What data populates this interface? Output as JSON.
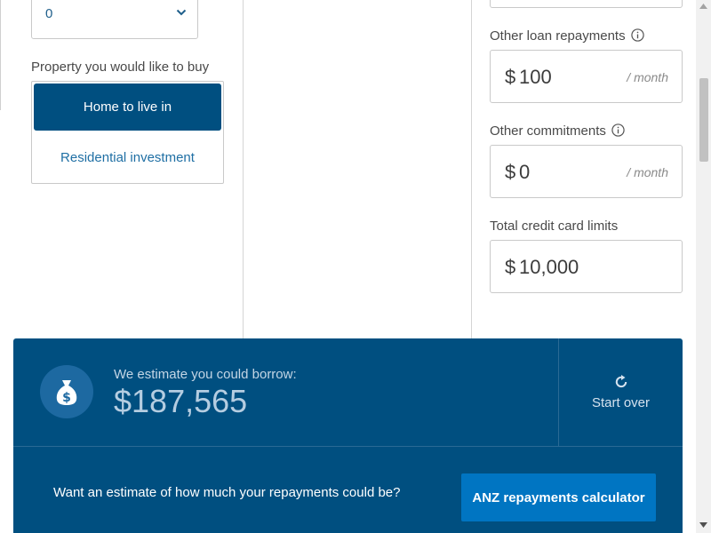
{
  "left": {
    "dependants_select": {
      "value": "0"
    },
    "property_label": "Property you would like to buy",
    "property_options": [
      {
        "label": "Home to live in",
        "selected": true
      },
      {
        "label": "Residential investment",
        "selected": false
      }
    ]
  },
  "right": {
    "other_loan": {
      "label": "Other loan repayments",
      "currency": "$",
      "value": "100",
      "unit": "/ month"
    },
    "other_commitments": {
      "label": "Other commitments",
      "currency": "$",
      "value": "0",
      "unit": "/ month"
    },
    "credit_limits": {
      "label": "Total credit card limits",
      "currency": "$",
      "value": "10,000"
    }
  },
  "result": {
    "estimate_label": "We estimate you could borrow:",
    "estimate_value": "$187,565",
    "start_over_label": "Start over",
    "repay_question": "Want an estimate of how much your repayments could be?",
    "repay_button_label": "ANZ repayments calculator"
  },
  "colors": {
    "panel": "#004f80",
    "button_active": "#004f80",
    "cta": "#0075c2",
    "link": "#1f6fa4"
  },
  "icons": [
    "chevron-down-icon",
    "info-icon",
    "money-bag-icon",
    "refresh-icon"
  ]
}
